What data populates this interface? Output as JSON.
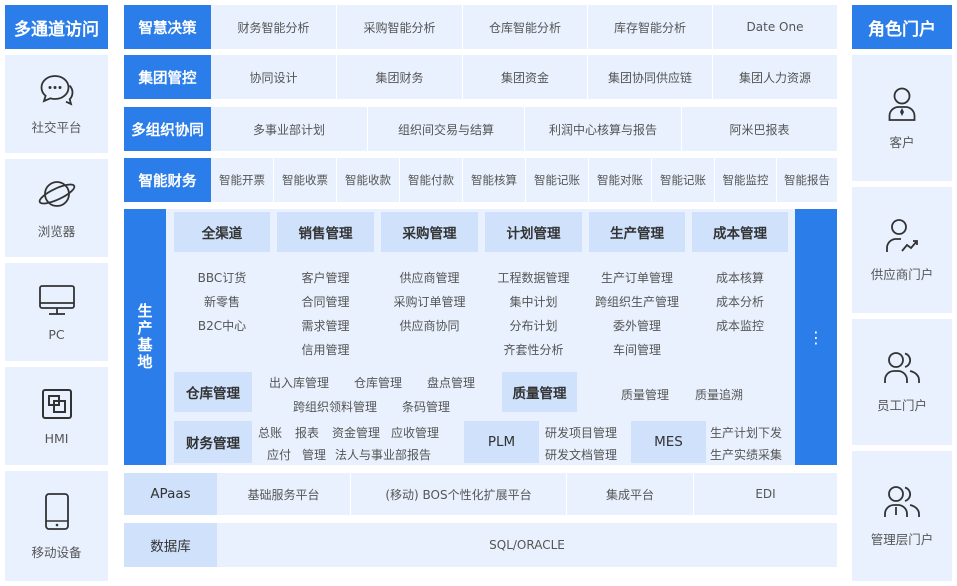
{
  "channels": {
    "title": "多通道访问",
    "items": [
      {
        "label": "社交平台",
        "icon": "chat-bubbles-icon"
      },
      {
        "label": "浏览器",
        "icon": "browser-planet-icon"
      },
      {
        "label": "PC",
        "icon": "monitor-icon"
      },
      {
        "label": "HMI",
        "icon": "hmi-panel-icon"
      },
      {
        "label": "移动设备",
        "icon": "tablet-icon"
      }
    ]
  },
  "roles": {
    "title": "角色门户",
    "items": [
      {
        "label": "客户",
        "icon": "customer-icon"
      },
      {
        "label": "供应商门户",
        "icon": "supplier-icon"
      },
      {
        "label": "员工门户",
        "icon": "employees-icon"
      },
      {
        "label": "管理层门户",
        "icon": "management-icon"
      }
    ]
  },
  "rows": {
    "decision": {
      "title": "智慧决策",
      "items": [
        "财务智能分析",
        "采购智能分析",
        "仓库智能分析",
        "库存智能分析",
        "Date One"
      ]
    },
    "group": {
      "title": "集团管控",
      "items": [
        "协同设计",
        "集团财务",
        "集团资金",
        "集团协同供应链",
        "集团人力资源"
      ]
    },
    "multiorg": {
      "title": "多组织协同",
      "items": [
        "多事业部计划",
        "组织间交易与结算",
        "利润中心核算与报告",
        "阿米巴报表"
      ]
    },
    "finance": {
      "title": "智能财务",
      "items": [
        "智能开票",
        "智能收票",
        "智能收款",
        "智能付款",
        "智能核算",
        "智能记账",
        "智能对账",
        "智能记账",
        "智能监控",
        "智能报告"
      ]
    }
  },
  "production": {
    "title": "生产基地",
    "more": "⋮",
    "modules": [
      {
        "title": "全渠道",
        "items": [
          "BBC订货",
          "新零售",
          "B2C中心"
        ]
      },
      {
        "title": "销售管理",
        "items": [
          "客户管理",
          "合同管理",
          "需求管理",
          "信用管理"
        ]
      },
      {
        "title": "采购管理",
        "items": [
          "供应商管理",
          "采购订单管理",
          "供应商协同"
        ]
      },
      {
        "title": "计划管理",
        "items": [
          "工程数据管理",
          "集中计划",
          "分布计划",
          "齐套性分析"
        ]
      },
      {
        "title": "生产管理",
        "items": [
          "生产订单管理",
          "跨组织生产管理",
          "委外管理",
          "车间管理"
        ]
      },
      {
        "title": "成本管理",
        "items": [
          "成本核算",
          "成本分析",
          "成本监控"
        ]
      }
    ],
    "warehouse": {
      "title": "仓库管理",
      "line1": [
        "出入库管理",
        "仓库管理",
        "盘点管理"
      ],
      "line2": [
        "跨组织领料管理",
        "条码管理"
      ]
    },
    "quality": {
      "title": "质量管理",
      "items": [
        "质量管理",
        "质量追溯"
      ]
    },
    "fin_mgmt": {
      "title": "财务管理",
      "line1": [
        "总账",
        "报表",
        "资金管理",
        "应收管理"
      ],
      "line2": [
        "应付",
        "管理",
        "法人与事业部报告"
      ]
    },
    "plm": {
      "title": "PLM",
      "items": [
        "研发项目管理",
        "研发文档管理"
      ]
    },
    "mes": {
      "title": "MES",
      "items": [
        "生产计划下发",
        "生产实绩采集"
      ]
    }
  },
  "apaas": {
    "title": "APaas",
    "items": [
      "基础服务平台",
      "(移动) BOS个性化扩展平台",
      "集成平台",
      "EDI"
    ]
  },
  "database": {
    "title": "数据库",
    "value": "SQL/ORACLE"
  }
}
